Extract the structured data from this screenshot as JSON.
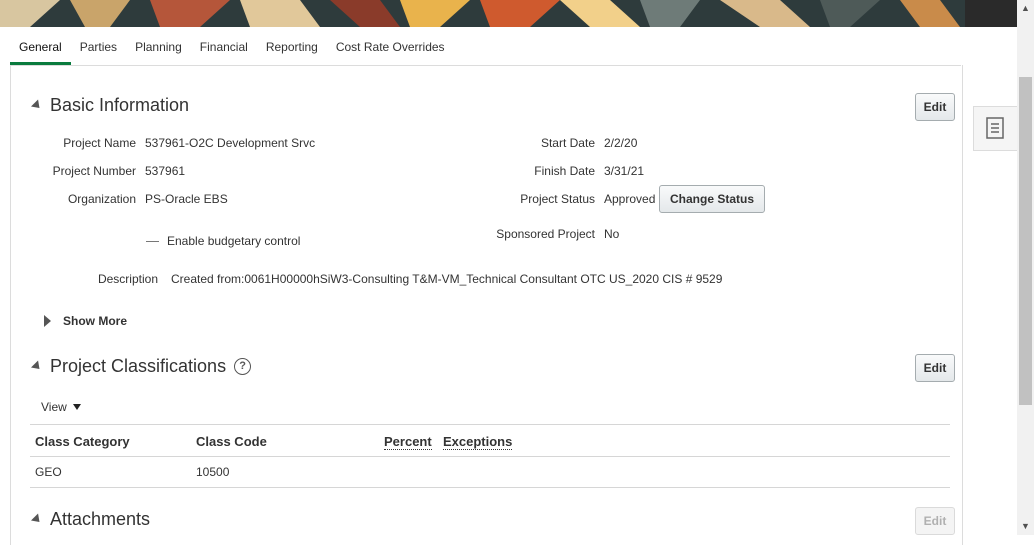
{
  "tabs": [
    {
      "label": "General",
      "active": true
    },
    {
      "label": "Parties"
    },
    {
      "label": "Planning"
    },
    {
      "label": "Financial"
    },
    {
      "label": "Reporting"
    },
    {
      "label": "Cost Rate Overrides"
    }
  ],
  "basic_info": {
    "title": "Basic Information",
    "edit_label": "Edit",
    "project_name_label": "Project Name",
    "project_name": "537961-O2C Development Srvc",
    "project_number_label": "Project Number",
    "project_number": "537961",
    "organization_label": "Organization",
    "organization": "PS-Oracle EBS",
    "budgetary_control_label": "Enable budgetary control",
    "start_date_label": "Start Date",
    "start_date": "2/2/20",
    "finish_date_label": "Finish Date",
    "finish_date": "3/31/21",
    "project_status_label": "Project Status",
    "project_status": "Approved",
    "change_status_label": "Change Status",
    "sponsored_label": "Sponsored Project",
    "sponsored": "No",
    "description_label": "Description",
    "description": "Created from:0061H00000hSiW3-Consulting T&M-VM_Technical Consultant OTC US_2020 CIS # 9529",
    "show_more_label": "Show More"
  },
  "classifications": {
    "title": "Project Classifications",
    "edit_label": "Edit",
    "view_label": "View",
    "columns": [
      "Class Category",
      "Class Code",
      "Percent",
      "Exceptions"
    ],
    "rows": [
      {
        "category": "GEO",
        "code": "10500",
        "percent": "",
        "exceptions": ""
      }
    ]
  },
  "attachments": {
    "title": "Attachments",
    "edit_label": "Edit"
  },
  "colors": {
    "active_tab": "#0a7b3e",
    "banner": "#2e3b3c"
  }
}
